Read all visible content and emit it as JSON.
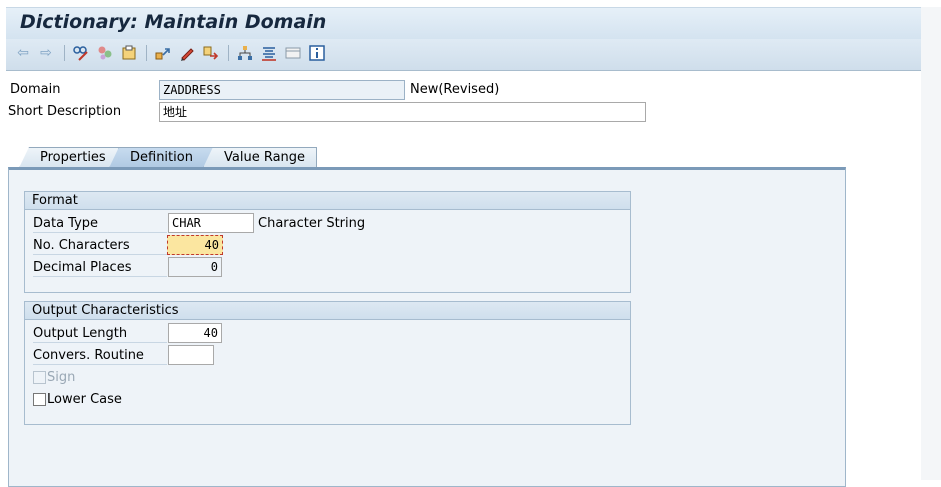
{
  "window": {
    "title": "Dictionary: Maintain Domain"
  },
  "toolbar": {
    "icons": [
      "back-arrow-icon",
      "forward-arrow-icon",
      "display-change-icon",
      "activate-icon",
      "check-icon",
      "where-used-icon",
      "edit-icon",
      "other-object-icon",
      "hierarchy-icon",
      "list-icon",
      "layout-icon",
      "info-icon"
    ]
  },
  "header": {
    "domain_label": "Domain",
    "domain_value": "ZADDRESS",
    "status": "New(Revised)",
    "short_desc_label": "Short Description",
    "short_desc_value": "地址"
  },
  "tabs": [
    {
      "label": "Properties"
    },
    {
      "label": "Definition"
    },
    {
      "label": "Value Range"
    }
  ],
  "format": {
    "title": "Format",
    "data_type_label": "Data Type",
    "data_type_value": "CHAR",
    "data_type_desc": "Character String",
    "no_chars_label": "No. Characters",
    "no_chars_value": "40",
    "decimal_label": "Decimal Places",
    "decimal_value": "0"
  },
  "output": {
    "title": "Output Characteristics",
    "output_length_label": "Output Length",
    "output_length_value": "40",
    "convers_label": "Convers. Routine",
    "convers_value": "",
    "sign_label": "Sign",
    "lower_case_label": "Lower Case"
  }
}
